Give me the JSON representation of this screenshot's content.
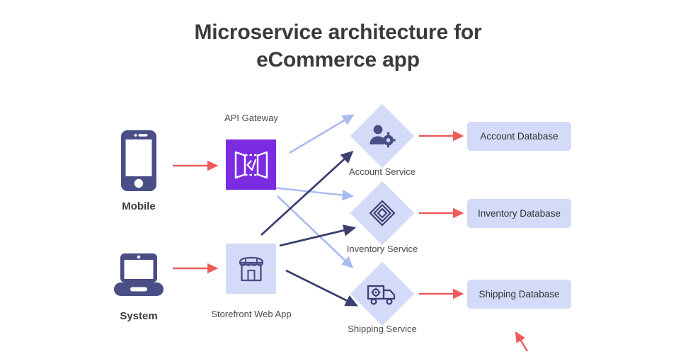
{
  "diagram": {
    "title_line1": "Microservice architecture for",
    "title_line2": "eCommerce app",
    "colors": {
      "gateway_purple": "#7B2CE0",
      "node_lavender": "#D3DBF8",
      "navy": "#4A4E86",
      "arrow_red": "#EE5A5A",
      "arrow_light_blue": "#A9BCF0",
      "arrow_dark_blue": "#3B3F72",
      "text_dark": "#3b3b3b",
      "text_gray": "#4a4a4a",
      "background": "#ffffff"
    },
    "clients": [
      {
        "id": "mobile",
        "label": "Mobile",
        "icon": "mobile-phone-icon"
      },
      {
        "id": "system",
        "label": "System",
        "icon": "laptop-icon"
      }
    ],
    "entrypoints": [
      {
        "id": "api-gateway",
        "label": "API Gateway",
        "icon": "api-gateway-icon",
        "label_position": "above"
      },
      {
        "id": "storefront",
        "label": "Storefront Web App",
        "icon": "storefront-shop-icon",
        "label_position": "below"
      }
    ],
    "services": [
      {
        "id": "account-service",
        "label": "Account Service",
        "icon": "user-gear-icon"
      },
      {
        "id": "inventory-service",
        "label": "Inventory Service",
        "icon": "concentric-diamond-icon"
      },
      {
        "id": "shipping-service",
        "label": "Shipping Service",
        "icon": "delivery-truck-icon"
      }
    ],
    "databases": [
      {
        "id": "account-database",
        "label": "Account Database"
      },
      {
        "id": "inventory-database",
        "label": "Inventory Database"
      },
      {
        "id": "shipping-database",
        "label": "Shipping Database"
      }
    ],
    "connections": [
      {
        "from": "mobile",
        "to": "api-gateway",
        "style": "red"
      },
      {
        "from": "system",
        "to": "storefront",
        "style": "red"
      },
      {
        "from": "api-gateway",
        "to": "account-service",
        "style": "light-blue"
      },
      {
        "from": "api-gateway",
        "to": "inventory-service",
        "style": "light-blue"
      },
      {
        "from": "api-gateway",
        "to": "shipping-service",
        "style": "light-blue"
      },
      {
        "from": "storefront",
        "to": "account-service",
        "style": "dark-blue"
      },
      {
        "from": "storefront",
        "to": "inventory-service",
        "style": "dark-blue"
      },
      {
        "from": "storefront",
        "to": "shipping-service",
        "style": "dark-blue"
      },
      {
        "from": "account-service",
        "to": "account-database",
        "style": "red"
      },
      {
        "from": "inventory-service",
        "to": "inventory-database",
        "style": "red"
      },
      {
        "from": "shipping-service",
        "to": "shipping-database",
        "style": "red"
      }
    ]
  }
}
